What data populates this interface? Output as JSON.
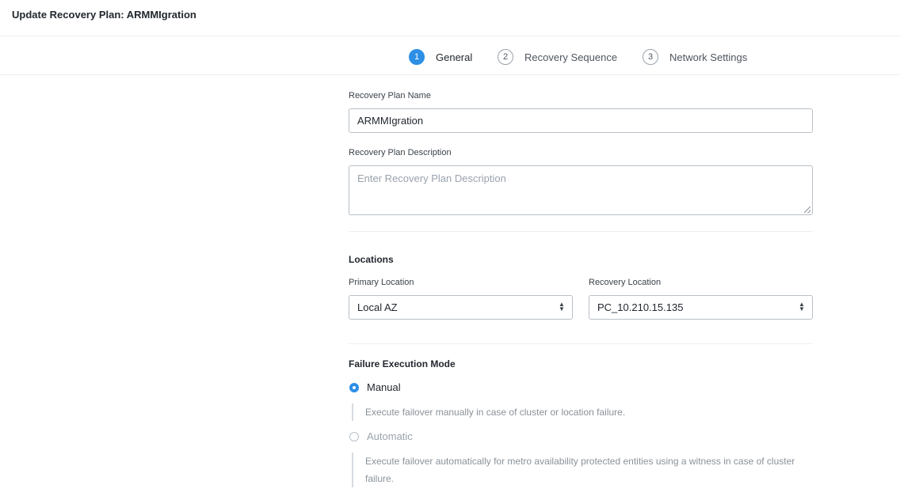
{
  "header": {
    "title": "Update Recovery Plan: ARMMIgration"
  },
  "stepper": {
    "steps": [
      {
        "number": "1",
        "label": "General",
        "active": true
      },
      {
        "number": "2",
        "label": "Recovery Sequence",
        "active": false
      },
      {
        "number": "3",
        "label": "Network Settings",
        "active": false
      }
    ]
  },
  "form": {
    "name_label": "Recovery Plan Name",
    "name_value": "ARMMIgration",
    "description_label": "Recovery Plan Description",
    "description_placeholder": "Enter Recovery Plan Description",
    "locations_title": "Locations",
    "primary_label": "Primary Location",
    "primary_value": "Local AZ",
    "recovery_label": "Recovery Location",
    "recovery_value": "PC_10.210.15.135",
    "failure_title": "Failure Execution Mode",
    "manual_label": "Manual",
    "manual_desc": "Execute failover manually in case of cluster or location failure.",
    "automatic_label": "Automatic",
    "automatic_desc": "Execute failover automatically for metro availability protected entities using a witness in case of cluster failure."
  },
  "colors": {
    "accent": "#2c8fe6",
    "border": "#b8bfc7",
    "muted": "#8a9299"
  }
}
